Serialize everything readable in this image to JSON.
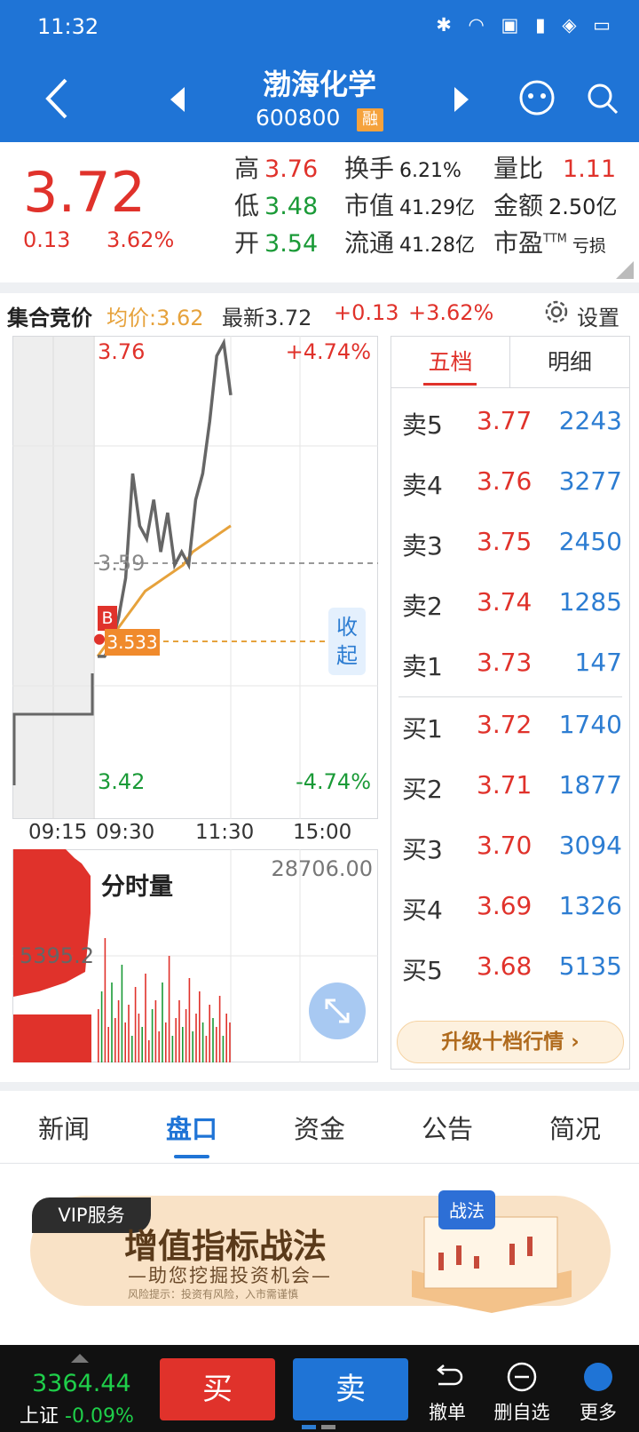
{
  "status": {
    "time": "11:32",
    "icons": [
      "bluetooth-icon",
      "wifi-icon",
      "hd-icon",
      "4g-signal-icon",
      "shield-icon",
      "battery-icon"
    ]
  },
  "header": {
    "name": "渤海化学",
    "code": "600800",
    "badge": "融"
  },
  "quote": {
    "price": "3.72",
    "change": "0.13",
    "change_pct": "3.62%",
    "high_label": "高",
    "high": "3.76",
    "low_label": "低",
    "low": "3.48",
    "open_label": "开",
    "open": "3.54",
    "turnover_label": "换手",
    "turnover": "6.21%",
    "mktcap_label": "市值",
    "mktcap": "41.29亿",
    "float_label": "流通",
    "float": "41.28亿",
    "volratio_label": "量比",
    "volratio": "1.11",
    "amount_label": "金额",
    "amount": "2.50亿",
    "pe_label": "市盈",
    "pe_sup": "TTM",
    "pe": "亏损"
  },
  "auction": {
    "label": "集合竞价",
    "avg_label": "均价:3.62",
    "latest": "最新3.72",
    "change": "+0.13",
    "pct": "+3.62%",
    "settings": "设置"
  },
  "chart": {
    "price_high": "3.76",
    "price_low": "3.42",
    "pct_high": "+4.74%",
    "pct_low": "-4.74%",
    "prev_close": "3.59",
    "marker_b": "B",
    "marker_price": "3.533",
    "collapse": "收起",
    "times": [
      "09:15",
      "09:30",
      "11:30",
      "15:00"
    ],
    "volume_label": "分时量",
    "volume_max": "28706.00",
    "volume_auction": "5395.2"
  },
  "chart_data": {
    "type": "line",
    "ylim": [
      3.42,
      3.76
    ],
    "x": [
      "09:15",
      "09:30",
      "11:30",
      "15:00"
    ],
    "series": [
      {
        "values": [
          3.52,
          3.52,
          3.53,
          3.55,
          3.58,
          3.66,
          3.62,
          3.61,
          3.64,
          3.6,
          3.63,
          3.59,
          3.6,
          3.59,
          3.64,
          3.66,
          3.7,
          3.75,
          3.76,
          3.72
        ]
      },
      {
        "values": [
          3.52,
          3.53,
          3.54,
          3.55,
          3.56,
          3.57,
          3.575,
          3.58,
          3.585,
          3.59,
          3.6,
          3.605,
          3.61,
          3.615,
          3.62
        ]
      }
    ]
  },
  "orderbook": {
    "tabs": [
      "五档",
      "明细"
    ],
    "rows": [
      {
        "label": "卖5",
        "price": "3.77",
        "vol": "2243"
      },
      {
        "label": "卖4",
        "price": "3.76",
        "vol": "3277"
      },
      {
        "label": "卖3",
        "price": "3.75",
        "vol": "2450"
      },
      {
        "label": "卖2",
        "price": "3.74",
        "vol": "1285"
      },
      {
        "label": "卖1",
        "price": "3.73",
        "vol": "147"
      },
      {
        "label": "买1",
        "price": "3.72",
        "vol": "1740"
      },
      {
        "label": "买2",
        "price": "3.71",
        "vol": "1877"
      },
      {
        "label": "买3",
        "price": "3.70",
        "vol": "3094"
      },
      {
        "label": "买4",
        "price": "3.69",
        "vol": "1326"
      },
      {
        "label": "买5",
        "price": "3.68",
        "vol": "5135"
      }
    ],
    "upgrade": "升级十档行情 ›"
  },
  "tabs": [
    "新闻",
    "盘口",
    "资金",
    "公告",
    "简况"
  ],
  "banner": {
    "tag": "VIP服务",
    "title": "增值指标战法",
    "sub": "—助您挖掘投资机会—",
    "risk": "风险提示：投资有风险，入市需谨慎",
    "art_label": "战法"
  },
  "bottom": {
    "index_value": "3364.44",
    "index_name": "上证",
    "index_change": "-0.09%",
    "buy": "买",
    "sell": "卖",
    "undo": "撤单",
    "remove": "删自选",
    "more": "更多"
  },
  "colors": {
    "brand_blue": "#1f74d6",
    "up_red": "#e0322b",
    "down_green": "#1a9a37",
    "avg_line": "#e6a23c"
  }
}
